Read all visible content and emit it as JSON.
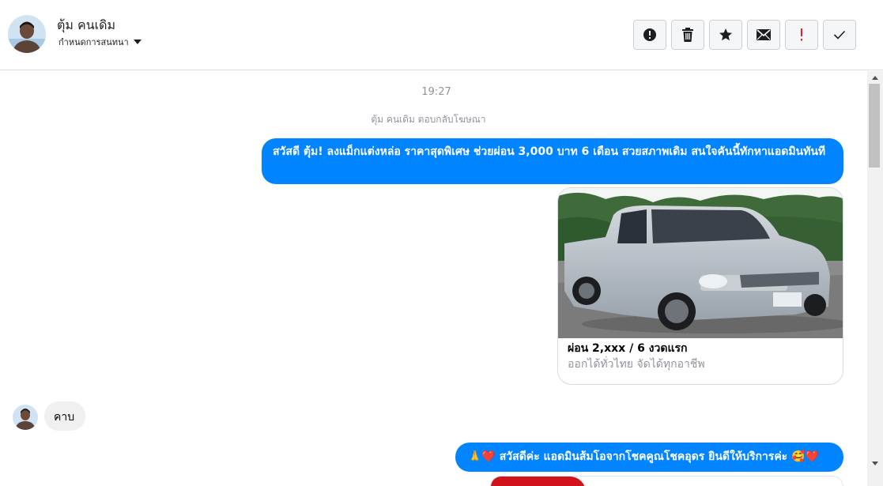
{
  "header": {
    "contact_name": "ตุ้ม คนเดิม",
    "assign_label": "กำหนดการสนทนา",
    "toolbar": [
      {
        "icon": "alert-circle-icon",
        "color": "#1c1e21"
      },
      {
        "icon": "trash-icon",
        "color": "#1c1e21"
      },
      {
        "icon": "star-icon",
        "color": "#1c1e21"
      },
      {
        "icon": "envelope-icon",
        "color": "#1c1e21"
      },
      {
        "icon": "exclamation-icon",
        "color": "#e02020"
      },
      {
        "icon": "checkmark-icon",
        "color": "#1c1e21"
      }
    ]
  },
  "chat": {
    "timestamp": "19:27",
    "reply_note": "ตุ้ม คนเดิม ตอบกลับโฆษณา",
    "messages": {
      "ad_text": "สวัสดี ตุ้ม! ลงแม็กแต่งหล่อ ราคาสุดพิเศษ ช่วยผ่อน 3,000 บาท 6 เดือน สวยสภาพเดิม สนใจคันนี้ทักหาแอดมินทันที",
      "card_title": "ผ่อน 2,xxx / 6 งวดแรก",
      "card_subtitle": "ออกได้ทั่วไทย จัดได้ทุกอาชีพ",
      "incoming": "คาบ",
      "greeting": "🙏❤️ สวัสดีค่ะ แอดมินส้มโอจากโชคคูณโชคอุดร ยินดีให้บริการค่ะ 🥰❤️"
    }
  },
  "colors": {
    "outgoing_bubble": "#0084ff",
    "incoming_bubble": "#f1f0f0",
    "meta_text": "#90949c"
  }
}
